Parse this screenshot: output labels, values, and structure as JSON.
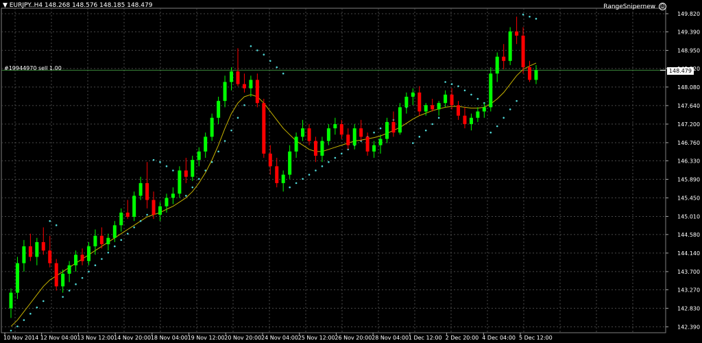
{
  "header": {
    "symbol": "EURJPY..H4",
    "ohlc": "148.268 148.576 148.185 148.479"
  },
  "indicator": {
    "name": "RangeSnipernew"
  },
  "order": {
    "label": "#19944970 sell 1.00"
  },
  "current_price": "148.479",
  "colors": {
    "background": "#000000",
    "grid": "#4a4a4a",
    "bull": "#00ff00",
    "bear": "#ff0000",
    "ma": "#c8b400",
    "sar": "#4fd6d6",
    "order_line": "#3b8a3b",
    "text": "#ffffff"
  },
  "chart_data": {
    "type": "candlestick",
    "symbol": "EURJPY",
    "timeframe": "H4",
    "y_ticks": [
      149.82,
      149.39,
      148.95,
      148.52,
      148.08,
      147.64,
      147.2,
      146.76,
      146.33,
      145.89,
      145.45,
      145.01,
      144.58,
      144.14,
      143.7,
      143.27,
      142.83,
      142.39
    ],
    "y_tick_labels": [
      "149.820",
      "149.390",
      "148.950",
      "148.520",
      "148.080",
      "147.640",
      "147.200",
      "146.760",
      "146.330",
      "145.890",
      "145.450",
      "145.010",
      "144.580",
      "144.140",
      "143.700",
      "143.270",
      "142.830",
      "142.390"
    ],
    "x_labels": [
      "10 Nov 2014",
      "12 Nov 04:00",
      "13 Nov 12:00",
      "14 Nov 20:00",
      "18 Nov 04:00",
      "19 Nov 12:00",
      "20 Nov 20:00",
      "24 Nov 04:00",
      "25 Nov 12:00",
      "26 Nov 20:00",
      "28 Nov 04:00",
      "1 Dec 12:00",
      "2 Dec 20:00",
      "4 Dec 04:00",
      "5 Dec 12:00"
    ],
    "ylim": [
      142.25,
      149.95
    ],
    "order_price": 148.479,
    "current_price": 148.479,
    "candles": [
      [
        142.83,
        143.3,
        142.6,
        143.2
      ],
      [
        143.2,
        144.05,
        143.05,
        143.9
      ],
      [
        143.9,
        144.45,
        143.7,
        144.3
      ],
      [
        144.3,
        144.6,
        143.95,
        144.05
      ],
      [
        144.05,
        144.5,
        143.85,
        144.4
      ],
      [
        144.4,
        144.75,
        144.1,
        144.2
      ],
      [
        144.2,
        144.55,
        143.8,
        143.9
      ],
      [
        143.9,
        144.0,
        143.25,
        143.35
      ],
      [
        143.35,
        143.75,
        143.2,
        143.65
      ],
      [
        143.65,
        143.95,
        143.45,
        143.85
      ],
      [
        143.85,
        144.2,
        143.7,
        144.1
      ],
      [
        144.1,
        144.25,
        143.85,
        143.95
      ],
      [
        143.95,
        144.4,
        143.85,
        144.3
      ],
      [
        144.3,
        144.7,
        144.1,
        144.55
      ],
      [
        144.55,
        144.75,
        144.25,
        144.35
      ],
      [
        144.35,
        144.6,
        144.2,
        144.5
      ],
      [
        144.5,
        144.9,
        144.4,
        144.8
      ],
      [
        144.8,
        145.2,
        144.65,
        145.1
      ],
      [
        145.1,
        145.4,
        144.95,
        145.0
      ],
      [
        145.0,
        145.6,
        144.9,
        145.5
      ],
      [
        145.5,
        145.95,
        145.4,
        145.8
      ],
      [
        145.8,
        146.3,
        145.2,
        145.4
      ],
      [
        145.4,
        145.6,
        144.95,
        145.05
      ],
      [
        145.05,
        145.35,
        144.9,
        145.25
      ],
      [
        145.25,
        145.55,
        145.1,
        145.45
      ],
      [
        145.45,
        145.7,
        145.3,
        145.55
      ],
      [
        145.55,
        146.2,
        145.45,
        146.1
      ],
      [
        146.1,
        146.4,
        145.8,
        145.95
      ],
      [
        145.95,
        146.45,
        145.85,
        146.35
      ],
      [
        146.35,
        146.65,
        146.2,
        146.55
      ],
      [
        146.55,
        147.0,
        146.4,
        146.9
      ],
      [
        146.9,
        147.45,
        146.8,
        147.35
      ],
      [
        147.35,
        147.85,
        147.2,
        147.75
      ],
      [
        147.75,
        148.35,
        147.6,
        148.2
      ],
      [
        148.2,
        148.55,
        148.0,
        148.45
      ],
      [
        148.45,
        149.0,
        148.1,
        148.15
      ],
      [
        148.15,
        148.4,
        147.95,
        148.05
      ],
      [
        148.05,
        148.35,
        147.85,
        148.25
      ],
      [
        148.25,
        148.4,
        147.6,
        147.7
      ],
      [
        147.7,
        147.8,
        146.4,
        146.5
      ],
      [
        146.5,
        146.7,
        146.0,
        146.2
      ],
      [
        146.2,
        146.4,
        145.7,
        145.8
      ],
      [
        145.8,
        146.1,
        145.6,
        146.0
      ],
      [
        146.0,
        146.7,
        145.9,
        146.55
      ],
      [
        146.55,
        147.0,
        146.4,
        146.9
      ],
      [
        146.9,
        147.3,
        146.8,
        147.1
      ],
      [
        147.1,
        147.2,
        146.7,
        146.8
      ],
      [
        146.8,
        146.9,
        146.3,
        146.45
      ],
      [
        146.45,
        146.9,
        146.3,
        146.8
      ],
      [
        146.8,
        147.2,
        146.7,
        147.1
      ],
      [
        147.1,
        147.35,
        146.95,
        147.2
      ],
      [
        147.2,
        147.3,
        146.85,
        146.95
      ],
      [
        146.95,
        147.1,
        146.6,
        146.7
      ],
      [
        146.7,
        147.2,
        146.6,
        147.1
      ],
      [
        147.1,
        147.3,
        146.8,
        146.9
      ],
      [
        146.9,
        147.0,
        146.45,
        146.55
      ],
      [
        146.55,
        146.8,
        146.4,
        146.7
      ],
      [
        146.7,
        146.95,
        146.5,
        146.85
      ],
      [
        146.85,
        147.35,
        146.75,
        147.25
      ],
      [
        147.25,
        147.5,
        146.9,
        147.0
      ],
      [
        147.0,
        147.7,
        146.95,
        147.6
      ],
      [
        147.6,
        147.95,
        147.45,
        147.85
      ],
      [
        147.85,
        148.05,
        147.65,
        147.95
      ],
      [
        147.95,
        148.1,
        147.4,
        147.5
      ],
      [
        147.5,
        147.7,
        147.4,
        147.65
      ],
      [
        147.65,
        147.8,
        147.5,
        147.55
      ],
      [
        147.55,
        147.75,
        147.4,
        147.7
      ],
      [
        147.7,
        148.0,
        147.6,
        147.9
      ],
      [
        147.9,
        148.05,
        147.55,
        147.65
      ],
      [
        147.65,
        147.75,
        147.3,
        147.4
      ],
      [
        147.4,
        147.6,
        147.1,
        147.2
      ],
      [
        147.2,
        147.45,
        147.05,
        147.35
      ],
      [
        147.35,
        147.6,
        147.25,
        147.5
      ],
      [
        147.5,
        147.7,
        147.35,
        147.6
      ],
      [
        147.6,
        148.55,
        147.5,
        148.4
      ],
      [
        148.4,
        148.9,
        148.2,
        148.8
      ],
      [
        148.8,
        149.1,
        148.5,
        148.7
      ],
      [
        148.7,
        149.5,
        148.6,
        149.4
      ],
      [
        149.4,
        149.75,
        149.1,
        149.3
      ],
      [
        149.3,
        149.5,
        148.4,
        148.55
      ],
      [
        148.55,
        148.7,
        148.2,
        148.25
      ],
      [
        148.25,
        148.6,
        148.15,
        148.48
      ]
    ],
    "moving_average": [
      142.4,
      142.55,
      142.75,
      142.95,
      143.15,
      143.35,
      143.5,
      143.6,
      143.7,
      143.8,
      143.9,
      144.0,
      144.1,
      144.2,
      144.3,
      144.4,
      144.5,
      144.6,
      144.7,
      144.8,
      144.9,
      145.0,
      145.05,
      145.1,
      145.18,
      145.25,
      145.35,
      145.45,
      145.6,
      145.8,
      146.05,
      146.35,
      146.7,
      147.1,
      147.45,
      147.7,
      147.85,
      147.9,
      147.85,
      147.7,
      147.5,
      147.3,
      147.1,
      146.95,
      146.8,
      146.7,
      146.6,
      146.55,
      146.55,
      146.6,
      146.65,
      146.7,
      146.75,
      146.8,
      146.82,
      146.85,
      146.88,
      146.92,
      146.98,
      147.05,
      147.12,
      147.22,
      147.32,
      147.4,
      147.46,
      147.52,
      147.56,
      147.6,
      147.62,
      147.62,
      147.6,
      147.58,
      147.58,
      147.6,
      147.68,
      147.8,
      147.95,
      148.15,
      148.35,
      148.5,
      148.58,
      148.65
    ],
    "sar": [
      142.3,
      142.4,
      142.55,
      142.7,
      142.85,
      143.0,
      144.9,
      144.8,
      143.1,
      143.25,
      143.4,
      143.55,
      143.7,
      143.85,
      144.0,
      144.15,
      144.3,
      144.45,
      144.6,
      144.75,
      144.9,
      145.05,
      146.35,
      146.3,
      146.2,
      146.1,
      146.0,
      145.5,
      145.7,
      145.9,
      146.1,
      146.3,
      146.55,
      146.8,
      147.05,
      147.35,
      147.65,
      149.05,
      148.95,
      148.85,
      148.7,
      148.55,
      148.4,
      145.7,
      145.8,
      145.9,
      146.0,
      146.1,
      146.2,
      146.3,
      146.4,
      146.5,
      146.6,
      146.7,
      146.8,
      146.9,
      147.0,
      147.1,
      147.2,
      147.3,
      147.45,
      147.6,
      146.75,
      146.9,
      147.05,
      147.2,
      147.35,
      148.2,
      148.15,
      148.1,
      148.0,
      147.9,
      147.8,
      147.7,
      147.0,
      147.15,
      147.35,
      147.55,
      147.75,
      149.8,
      149.75,
      149.7
    ]
  }
}
